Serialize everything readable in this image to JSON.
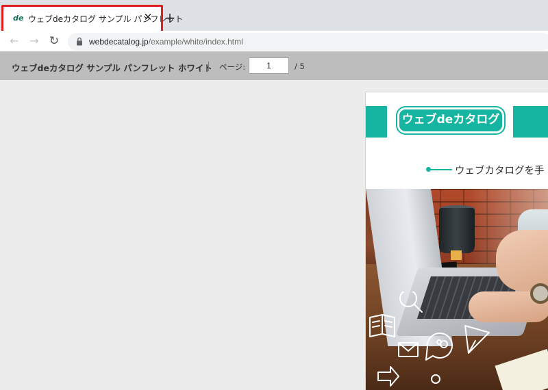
{
  "browser": {
    "tab": {
      "favicon_text": "de",
      "title": "ウェブdeカタログ サンプル パンフレット",
      "close_glyph": "✕"
    },
    "new_tab_glyph": "+",
    "nav": {
      "back_glyph": "←",
      "forward_glyph": "→",
      "reload_glyph": "↻"
    },
    "url": {
      "host": "webdecatalog.jp",
      "path": "/example/white/index.html"
    },
    "highlight_color": "#e02020"
  },
  "viewer": {
    "title": "ウェブdeカタログ サンプル パンフレット ホワイト",
    "page_label": "ページ:",
    "current_page": "1",
    "total_pages": "/ 5"
  },
  "page_content": {
    "logo_text": "ウェブdeカタログ",
    "subtitle": "ウェブカタログを手",
    "accent_color": "#15b5a1"
  }
}
